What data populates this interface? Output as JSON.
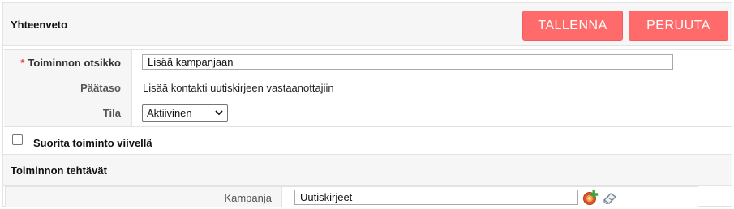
{
  "header": {
    "title": "Yhteenveto",
    "save_label": "TALLENNA",
    "cancel_label": "PERUUTA"
  },
  "form": {
    "title_row": {
      "required_mark": "*",
      "label": "Toiminnon otsikko",
      "value": "Lisää kampanjaan"
    },
    "main_level_row": {
      "label": "Päätaso",
      "value": "Lisää kontakti uutiskirjeen vastaanottajiin"
    },
    "status_row": {
      "label": "Tila",
      "selected": "Aktiivinen"
    }
  },
  "delay": {
    "checked": false,
    "label": "Suorita toiminto viivellä"
  },
  "tasks": {
    "title": "Toiminnon tehtävät",
    "campaign": {
      "label": "Kampanja",
      "value": "Uutiskirjeet",
      "add_icon": "add-icon",
      "clear_icon": "eraser-icon"
    }
  },
  "colors": {
    "button_bg": "#ff6b6b",
    "panel_bg": "#f6f6f6",
    "border": "#e3e3e3",
    "required": "#e44444"
  }
}
